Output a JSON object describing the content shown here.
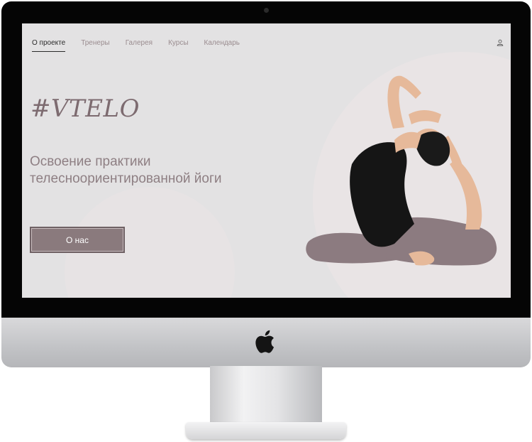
{
  "nav": {
    "items": [
      {
        "label": "О проекте",
        "active": true
      },
      {
        "label": "Тренеры",
        "active": false
      },
      {
        "label": "Галерея",
        "active": false
      },
      {
        "label": "Курсы",
        "active": false
      },
      {
        "label": "Календарь",
        "active": false
      }
    ],
    "user_icon": "user-icon"
  },
  "hero": {
    "logo": "#VTELO",
    "headline": "Освоение практики телесноориентированной йоги",
    "cta_label": "О нас"
  },
  "colors": {
    "screen_bg": "#e3e2e3",
    "accent": "#8a7a7d",
    "logo": "#7d6b70",
    "headline": "#8e7f83"
  }
}
